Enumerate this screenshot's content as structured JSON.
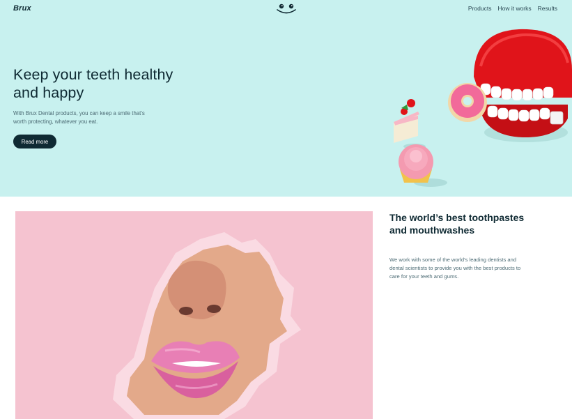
{
  "brand": {
    "logo_text": "Brux"
  },
  "nav": {
    "items": [
      {
        "label": "Products"
      },
      {
        "label": "How it works"
      },
      {
        "label": "Results"
      }
    ]
  },
  "hero": {
    "title": "Keep your teeth healthy and happy",
    "description": "With Brux Dental products, you can keep a smile that’s worth protecting, whatever you eat.",
    "cta_label": "Read more",
    "background_color": "#c8f1ef",
    "image": "wind-up-chattering-teeth-with-candy-icon"
  },
  "feature": {
    "title": "The world’s best toothpastes and mouthwashes",
    "description": "We work with some of the world’s leading dentists and dental scientists to provide you with the best products to care for your teeth and gums.",
    "image": "lips-through-torn-pink-paper-icon"
  },
  "colors": {
    "primary": "#0f2a33",
    "hero_bg": "#c8f1ef",
    "feature_pink": "#f5c3d0"
  }
}
